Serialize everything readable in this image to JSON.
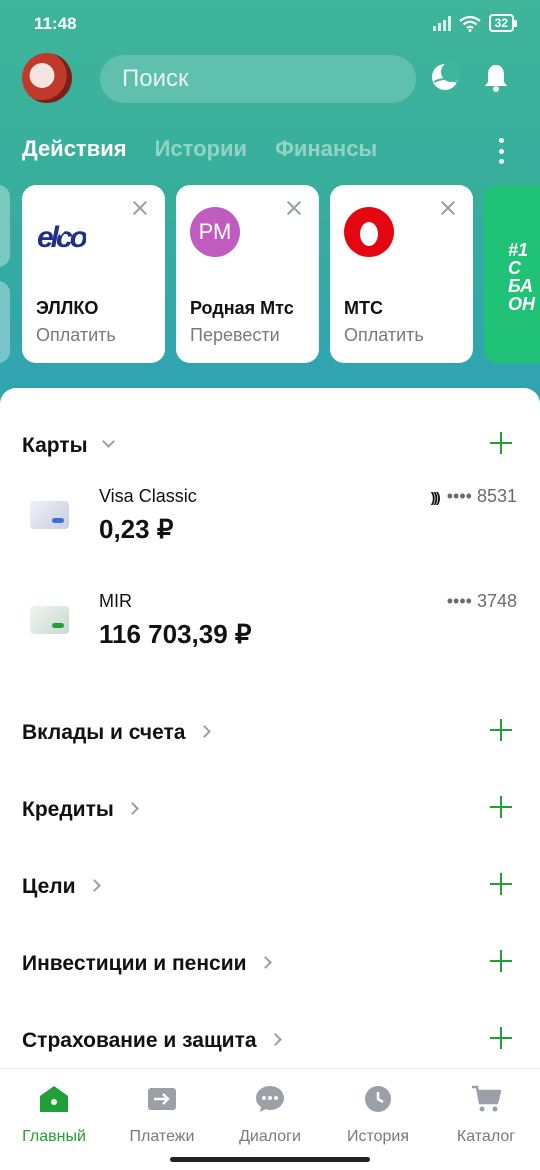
{
  "status_bar": {
    "time": "11:48",
    "battery": "32"
  },
  "header": {
    "search_placeholder": "Поиск",
    "tabs": [
      {
        "label": "Действия",
        "active": true
      },
      {
        "label": "Истории",
        "active": false
      },
      {
        "label": "Финансы",
        "active": false
      }
    ]
  },
  "actions": [
    {
      "title": "ЭЛЛКО",
      "subtitle": "Оплатить",
      "logo": "ellco-logo"
    },
    {
      "title": "Родная Мтс",
      "subtitle": "Перевести",
      "logo": "rm-avatar",
      "initials": "РМ"
    },
    {
      "title": "МТС",
      "subtitle": "Оплатить",
      "logo": "mts-logo"
    }
  ],
  "promo": {
    "line1": "#1",
    "line2": "С",
    "line3": "БА",
    "line4": "ОН"
  },
  "cards_section": {
    "title": "Карты",
    "cards": [
      {
        "name": "Visa Classic",
        "amount": "0,23 ₽",
        "number": "•••• 8531",
        "contactless": true,
        "stripe_color": "#3b6fd8"
      },
      {
        "name": "MIR",
        "amount": "116 703,39 ₽",
        "number": "•••• 3748",
        "contactless": false,
        "stripe_color": "#21a038"
      }
    ]
  },
  "sections": [
    {
      "title": "Вклады и счета"
    },
    {
      "title": "Кредиты"
    },
    {
      "title": "Цели"
    },
    {
      "title": "Инвестиции и пенсии"
    },
    {
      "title": "Страхование и защита"
    }
  ],
  "bottom_nav": [
    {
      "label": "Главный",
      "icon": "home-icon",
      "active": true
    },
    {
      "label": "Платежи",
      "icon": "payments-icon",
      "active": false
    },
    {
      "label": "Диалоги",
      "icon": "dialogs-icon",
      "active": false
    },
    {
      "label": "История",
      "icon": "history-icon",
      "active": false
    },
    {
      "label": "Каталог",
      "icon": "cart-icon",
      "active": false
    }
  ],
  "colors": {
    "accent": "#21a038",
    "header_top": "#3fb59b",
    "header_bottom": "#2fa1b6",
    "promo": "#1fc277"
  }
}
